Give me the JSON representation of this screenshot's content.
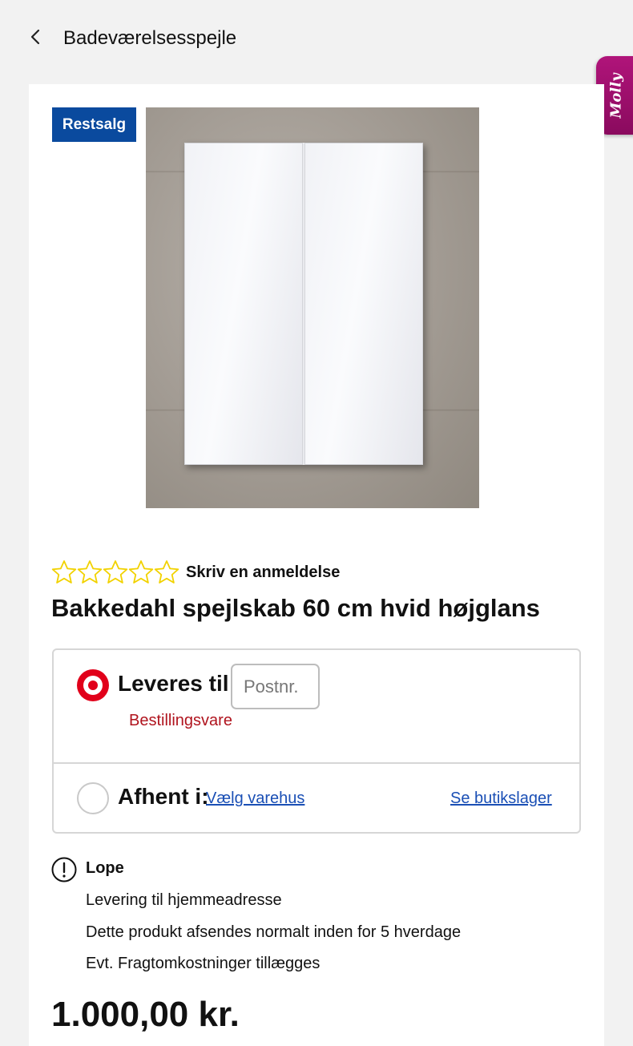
{
  "header": {
    "back_icon": "chevron-left-icon",
    "title": "Badeværelsesspejle"
  },
  "assistant_tab": {
    "label": "Molly",
    "color": "#9b0f6c"
  },
  "product": {
    "badge": "Restsalg",
    "badge_color": "#0a4a9e",
    "image_alt": "mirror cabinet with two doors",
    "rating": {
      "stars_filled": 0,
      "stars_total": 5,
      "star_color": "#f5d800",
      "review_link": "Skriv en anmeldelse"
    },
    "title": "Bakkedahl spejlskab 60 cm hvid højglans",
    "price": "1.000,00 kr."
  },
  "delivery": {
    "ship_option": {
      "label": "Leveres til:",
      "selected": true,
      "postcode_placeholder": "Postnr.",
      "postcode_value": "",
      "status": "Bestillingsvare"
    },
    "pickup_option": {
      "label": "Afhent i:",
      "selected": false,
      "choose_store_link": "Vælg varehus",
      "stock_link": "Se butikslager"
    },
    "accent_color": "#e1001a"
  },
  "info": {
    "icon": "exclamation-circle-icon",
    "title": "Lope",
    "lines": [
      "Levering til hjemmeadresse",
      "Dette produkt afsendes normalt inden for 5 hverdage",
      "Evt. Fragtomkostninger tillægges"
    ]
  }
}
